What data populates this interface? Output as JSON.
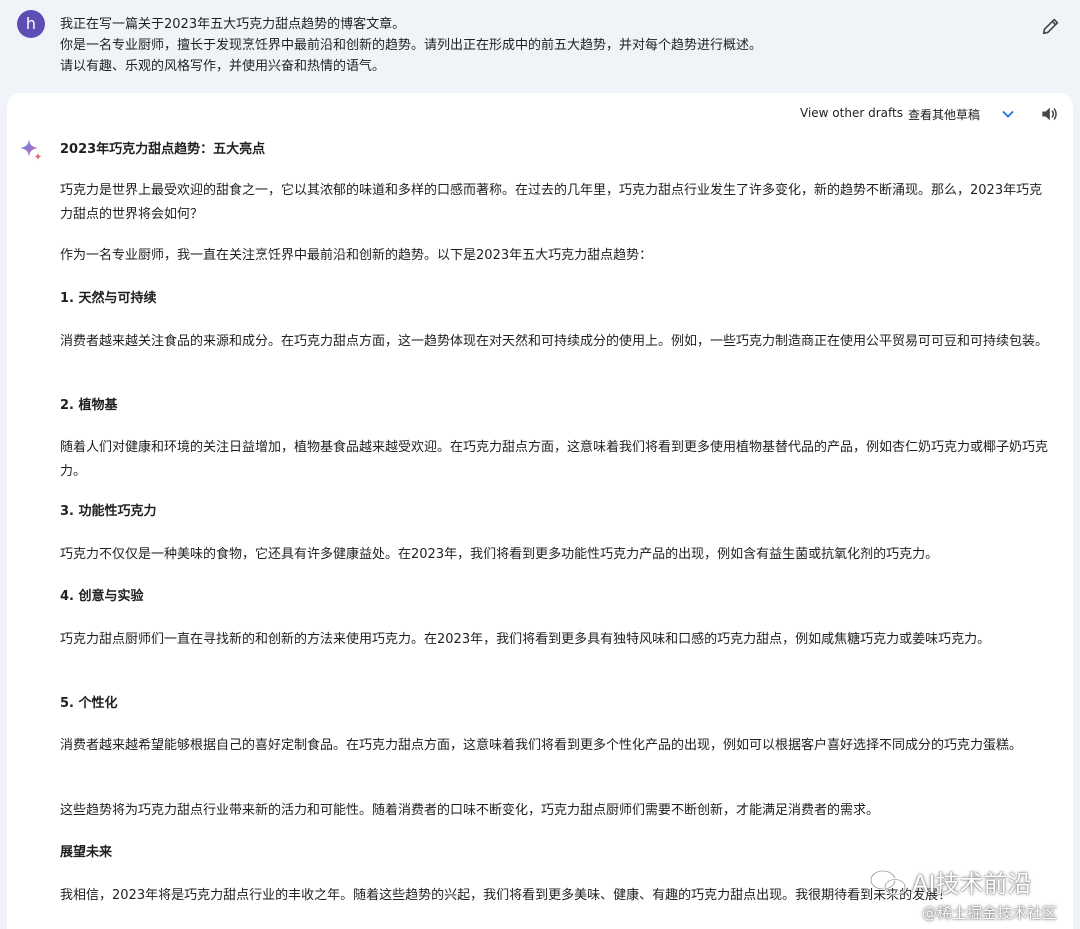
{
  "user": {
    "avatar_letter": "h",
    "prompt_lines": [
      "我正在写一篇关于2023年五大巧克力甜点趋势的博客文章。",
      "你是一名专业厨师，擅长于发现烹饪界中最前沿和创新的趋势。请列出正在形成中的前五大趋势，并对每个趋势进行概述。",
      "请以有趣、乐观的风格写作，并使用兴奋和热情的语气。"
    ]
  },
  "toolbar": {
    "drafts_label": "View other drafts",
    "drafts_label_zh": "查看其他草稿"
  },
  "response": {
    "title": "2023年巧克力甜点趋势：五大亮点",
    "intro_1": "巧克力是世界上最受欢迎的甜食之一，它以其浓郁的味道和多样的口感而著称。在过去的几年里，巧克力甜点行业发生了许多变化，新的趋势不断涌现。那么，2023年巧克力甜点的世界将会如何？",
    "intro_2": "作为一名专业厨师，我一直在关注烹饪界中最前沿和创新的趋势。以下是2023年五大巧克力甜点趋势：",
    "trends": [
      {
        "heading": "1. 天然与可持续",
        "body": "消费者越来越关注食品的来源和成分。在巧克力甜点方面，这一趋势体现在对天然和可持续成分的使用上。例如，一些巧克力制造商正在使用公平贸易可可豆和可持续包装。"
      },
      {
        "heading": "2. 植物基",
        "body": "随着人们对健康和环境的关注日益增加，植物基食品越来越受欢迎。在巧克力甜点方面，这意味着我们将看到更多使用植物基替代品的产品，例如杏仁奶巧克力或椰子奶巧克力。"
      },
      {
        "heading": "3. 功能性巧克力",
        "body": "巧克力不仅仅是一种美味的食物，它还具有许多健康益处。在2023年，我们将看到更多功能性巧克力产品的出现，例如含有益生菌或抗氧化剂的巧克力。"
      },
      {
        "heading": "4. 创意与实验",
        "body": "巧克力甜点厨师们一直在寻找新的和创新的方法来使用巧克力。在2023年，我们将看到更多具有独特风味和口感的巧克力甜点，例如咸焦糖巧克力或姜味巧克力。"
      },
      {
        "heading": "5. 个性化",
        "body": "消费者越来越希望能够根据自己的喜好定制食品。在巧克力甜点方面，这意味着我们将看到更多个性化产品的出现，例如可以根据客户喜好选择不同成分的巧克力蛋糕。"
      }
    ],
    "summary": "这些趋势将为巧克力甜点行业带来新的活力和可能性。随着消费者的口味不断变化，巧克力甜点厨师们需要不断创新，才能满足消费者的需求。",
    "outlook_heading": "展望未来",
    "outlook_body": "我相信，2023年将是巧克力甜点行业的丰收之年。随着这些趋势的兴起，我们将看到更多美味、健康、有趣的巧克力甜点出现。我很期待看到未来的发展！"
  },
  "watermark": {
    "main": "AI技术前沿",
    "sub": "@稀土掘金技术社区"
  },
  "colors": {
    "background": "#f0f4f9",
    "card": "#ffffff",
    "avatar": "#5e4db2",
    "accent_blue": "#1a73e8",
    "text": "#1f1f1f"
  },
  "icons": [
    "edit-pencil-icon",
    "chevron-down-icon",
    "speaker-icon",
    "gemini-sparkle-icon"
  ]
}
